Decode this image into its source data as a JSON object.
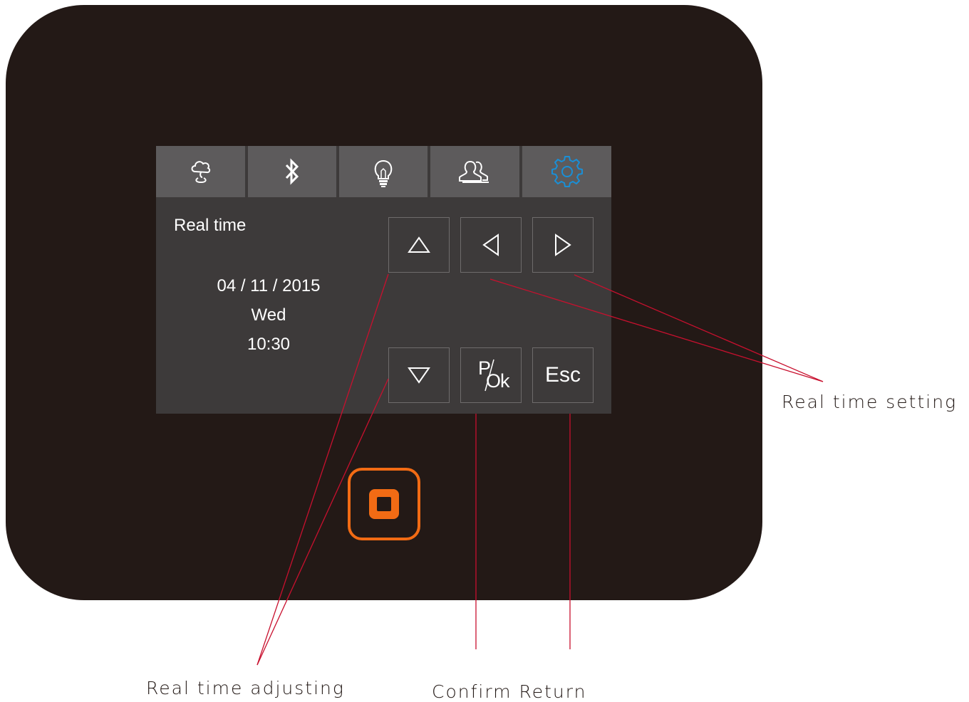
{
  "screen": {
    "title": "Real time",
    "date": "04 / 11 / 2015",
    "weekday": "Wed",
    "time": "10:30"
  },
  "tabs": [
    {
      "icon": "cloud-fountain-icon",
      "active": false
    },
    {
      "icon": "bluetooth-icon",
      "active": false
    },
    {
      "icon": "light-bulb-icon",
      "active": false
    },
    {
      "icon": "users-icon",
      "active": false
    },
    {
      "icon": "gear-icon",
      "active": true
    }
  ],
  "keys": {
    "up": {
      "icon": "triangle-up-icon"
    },
    "left": {
      "icon": "triangle-left-icon"
    },
    "right": {
      "icon": "triangle-right-icon"
    },
    "down": {
      "icon": "triangle-down-icon"
    },
    "p_ok": {
      "top": "P",
      "bottom": "Ok"
    },
    "esc": {
      "label": "Esc"
    }
  },
  "home_button": {
    "icon": "square-stop-icon"
  },
  "captions": {
    "setting": "Real time setting",
    "adjusting": "Real time adjusting",
    "confirm_return": "Confirm Return"
  },
  "colors": {
    "device_body": "#231916",
    "screen_bg": "#3d3a3a",
    "tab_bg": "#5d5b5c",
    "active_icon": "#1a8fd6",
    "home_accent": "#f26b14",
    "callout_line": "#c8102e"
  }
}
